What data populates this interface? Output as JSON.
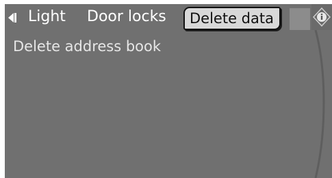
{
  "tabs": [
    {
      "label": "Light",
      "selected": false
    },
    {
      "label": "Door locks",
      "selected": false
    },
    {
      "label": "Delete data",
      "selected": true
    }
  ],
  "icons": {
    "back": "back-arrow-icon",
    "info": "info-icon"
  },
  "content": {
    "items": [
      {
        "label": "Delete address book"
      }
    ]
  },
  "colors": {
    "screen_background": "#707070",
    "text": "#ffffff",
    "selected_tab_background": "#d8d8d8",
    "selected_tab_text": "#111111"
  }
}
